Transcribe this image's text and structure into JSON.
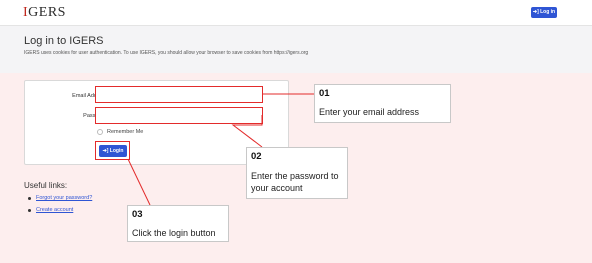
{
  "navbar": {
    "logo_first": "I",
    "logo_rest": "GERS",
    "login_label": "➔] Log in",
    "login_icon": "sign-in-icon"
  },
  "header": {
    "title": "Log in to IGERS",
    "cookie_notice": "IGERS uses cookies for user authentication. To use IGERS, you should allow your browser to save cookies from https://igers.org"
  },
  "form": {
    "email_label": "Email Address",
    "password_label": "Password",
    "required_mark": "*",
    "email_value": "",
    "password_value": "",
    "remember_label": "Remember Me",
    "login_button": "➔] Login"
  },
  "links": {
    "title": "Useful links:",
    "items": [
      "Forgot your password?",
      "Create account"
    ]
  },
  "callouts": [
    {
      "num": "01",
      "text": "Enter your email address"
    },
    {
      "num": "02",
      "text": "Enter the password to your account"
    },
    {
      "num": "03",
      "text": "Click the login button"
    }
  ],
  "colors": {
    "accent": "#2f55d4",
    "highlight": "#e32b2b",
    "background": "#fdeeee"
  }
}
